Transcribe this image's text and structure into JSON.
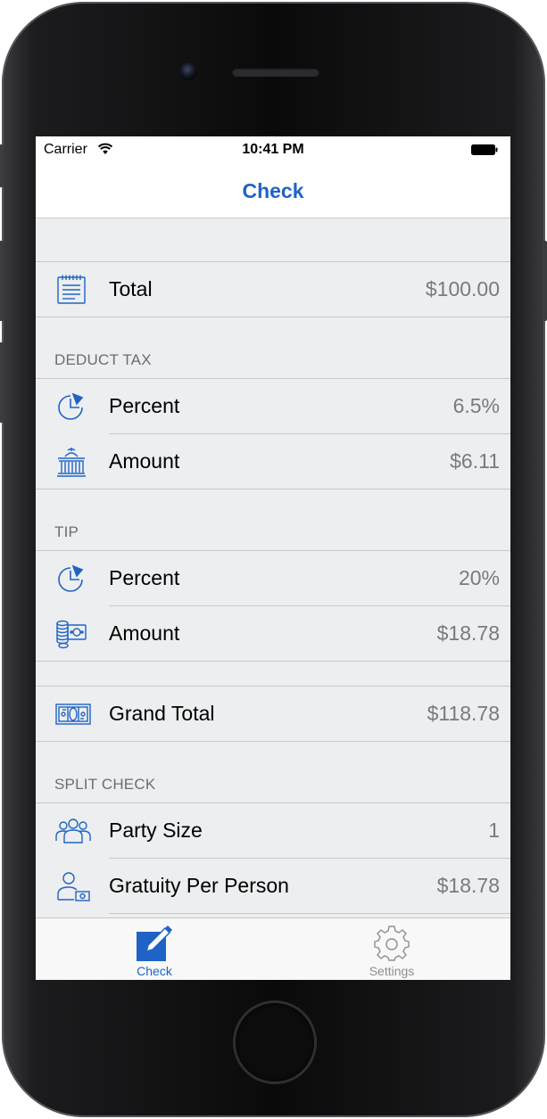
{
  "status_bar": {
    "carrier": "Carrier",
    "time": "10:41 PM"
  },
  "nav": {
    "title": "Check"
  },
  "total_row": {
    "label": "Total",
    "value": "$100.00",
    "icon": "receipt-icon"
  },
  "deduct_tax": {
    "header": "DEDUCT TAX",
    "rows": [
      {
        "label": "Percent",
        "value": "6.5%",
        "icon": "pie-chart-icon"
      },
      {
        "label": "Amount",
        "value": "$6.11",
        "icon": "capitol-building-icon"
      }
    ]
  },
  "tip": {
    "header": "TIP",
    "rows": [
      {
        "label": "Percent",
        "value": "20%",
        "icon": "pie-chart-icon"
      },
      {
        "label": "Amount",
        "value": "$18.78",
        "icon": "coins-and-bill-icon"
      }
    ]
  },
  "grand_total_row": {
    "label": "Grand Total",
    "value": "$118.78",
    "icon": "money-bills-icon"
  },
  "split_check": {
    "header": "SPLIT CHECK",
    "rows": [
      {
        "label": "Party Size",
        "value": "1",
        "icon": "group-people-icon"
      },
      {
        "label": "Gratuity Per Person",
        "value": "$18.78",
        "icon": "person-with-money-icon"
      }
    ]
  },
  "tabs": [
    {
      "label": "Check",
      "icon": "pencil-square-icon",
      "selected": true
    },
    {
      "label": "Settings",
      "icon": "gear-icon",
      "selected": false
    }
  ],
  "colors": {
    "accent": "#1f63c6",
    "background": "#eceeef",
    "value_text": "#7a7a7e",
    "separator": "#c8c8cc",
    "inactive_tab": "#8e8e93"
  }
}
